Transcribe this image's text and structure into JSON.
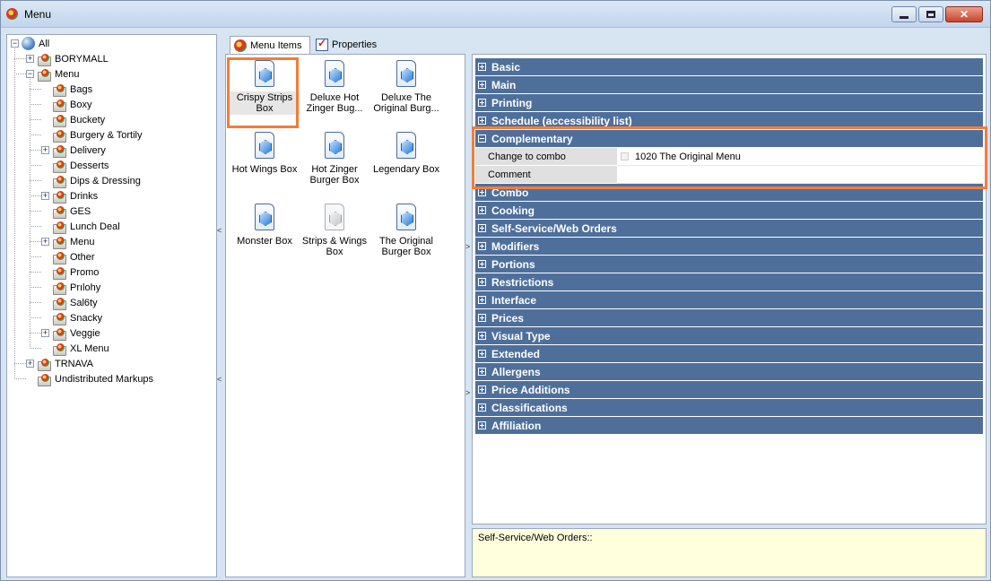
{
  "window": {
    "title": "Menu"
  },
  "tree": {
    "items": [
      {
        "label": "All",
        "expander": "−"
      },
      {
        "label": "BORYMALL",
        "expander": "+"
      },
      {
        "label": "Menu",
        "expander": "−"
      },
      {
        "label": "Bags",
        "expander": ""
      },
      {
        "label": "Boxy",
        "expander": ""
      },
      {
        "label": "Buckety",
        "expander": ""
      },
      {
        "label": "Burgery & Tortily",
        "expander": ""
      },
      {
        "label": "Delivery",
        "expander": "+"
      },
      {
        "label": "Desserts",
        "expander": ""
      },
      {
        "label": "Dips & Dressing",
        "expander": ""
      },
      {
        "label": "Drinks",
        "expander": "+"
      },
      {
        "label": "GES",
        "expander": ""
      },
      {
        "label": "Lunch Deal",
        "expander": ""
      },
      {
        "label": "Menu",
        "expander": "+"
      },
      {
        "label": "Other",
        "expander": ""
      },
      {
        "label": "Promo",
        "expander": ""
      },
      {
        "label": "Prılohy",
        "expander": ""
      },
      {
        "label": "Sal6ty",
        "expander": ""
      },
      {
        "label": "Snacky",
        "expander": ""
      },
      {
        "label": "Veggie",
        "expander": "+"
      },
      {
        "label": "XL Menu",
        "expander": ""
      },
      {
        "label": "TRNAVA",
        "expander": "+"
      },
      {
        "label": "Undistributed Markups",
        "expander": ""
      }
    ]
  },
  "splitter": {
    "collapse_glyph": "<",
    "expand_glyph": ">"
  },
  "tabs": [
    {
      "label": "Menu Items",
      "icon": "menu-logo-icon"
    },
    {
      "label": "Properties",
      "icon": "properties-icon"
    }
  ],
  "menu_items": [
    {
      "label": "Crispy Strips Box",
      "selected": true
    },
    {
      "label": "Deluxe Hot Zinger Bug...",
      "selected": false
    },
    {
      "label": "Deluxe The Original Burg...",
      "selected": false
    },
    {
      "label": "Hot Wings Box",
      "selected": false
    },
    {
      "label": "Hot Zinger Burger Box",
      "selected": false
    },
    {
      "label": "Legendary Box",
      "selected": false
    },
    {
      "label": "Monster Box",
      "selected": false
    },
    {
      "label": "Strips & Wings Box",
      "selected": false,
      "disabled": true
    },
    {
      "label": "The Original Burger Box",
      "selected": false
    }
  ],
  "property_grid": {
    "categories_top": [
      {
        "label": "Basic",
        "toggle": "plus"
      },
      {
        "label": "Main",
        "toggle": "plus"
      },
      {
        "label": "Printing",
        "toggle": "plus"
      },
      {
        "label": "Schedule (accessibility list)",
        "toggle": "plus"
      },
      {
        "label": "Complementary",
        "toggle": "minus"
      }
    ],
    "complementary_rows": [
      {
        "name": "Change to combo",
        "value": "1020 The Original Menu",
        "checkbox": true
      },
      {
        "name": "Comment",
        "value": "",
        "checkbox": false
      }
    ],
    "categories_bottom": [
      {
        "label": "Combo",
        "toggle": "plus"
      },
      {
        "label": "Cooking",
        "toggle": "plus"
      },
      {
        "label": "Self-Service/Web Orders",
        "toggle": "plus"
      },
      {
        "label": "Modifiers",
        "toggle": "plus"
      },
      {
        "label": "Portions",
        "toggle": "plus"
      },
      {
        "label": "Restrictions",
        "toggle": "plus"
      },
      {
        "label": "Interface",
        "toggle": "plus"
      },
      {
        "label": "Prices",
        "toggle": "plus"
      },
      {
        "label": "Visual Type",
        "toggle": "plus"
      },
      {
        "label": "Extended",
        "toggle": "plus"
      },
      {
        "label": "Allergens",
        "toggle": "plus"
      },
      {
        "label": "Price Additions",
        "toggle": "plus"
      },
      {
        "label": "Classifications",
        "toggle": "plus"
      },
      {
        "label": "Affiliation",
        "toggle": "plus"
      }
    ]
  },
  "description": {
    "text": "Self-Service/Web Orders::"
  },
  "colors": {
    "category_bg": "#4f6f9b",
    "highlight": "#f27d3a",
    "description_bg": "#ffffdd"
  }
}
